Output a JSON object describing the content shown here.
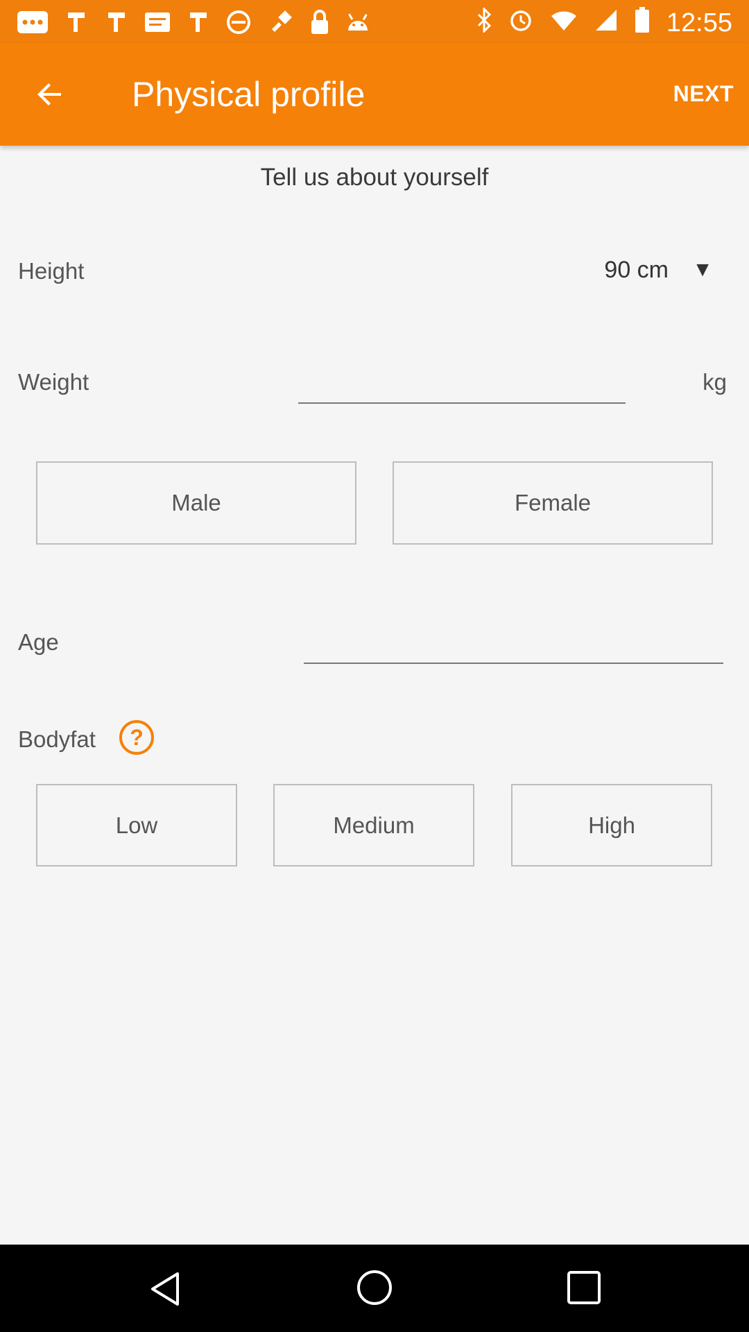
{
  "status_bar": {
    "time": "12:55"
  },
  "app_bar": {
    "title": "Physical profile",
    "next_label": "NEXT"
  },
  "subtitle": "Tell us about yourself",
  "height": {
    "label": "Height",
    "value": "90 cm"
  },
  "weight": {
    "label": "Weight",
    "value": "",
    "unit": "kg"
  },
  "gender": {
    "male_label": "Male",
    "female_label": "Female"
  },
  "age": {
    "label": "Age",
    "value": ""
  },
  "bodyfat": {
    "label": "Bodyfat",
    "options": [
      "Low",
      "Medium",
      "High"
    ]
  },
  "colors": {
    "accent": "#f58109",
    "status_bar": "#f07f0b",
    "background": "#f5f5f5"
  }
}
